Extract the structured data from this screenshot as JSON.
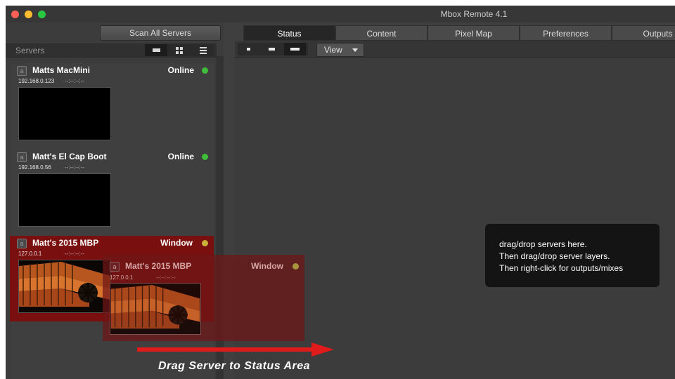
{
  "window": {
    "title": "Mbox Remote 4.1",
    "traffic_lights": {
      "close": "#fe5f57",
      "minimize": "#febc2e",
      "zoom": "#28c840"
    }
  },
  "left": {
    "scan_button_label": "Scan All Servers",
    "servers_label": "Servers",
    "view_modes": [
      "list-view-icon",
      "grid-view-icon",
      "detail-view-icon"
    ]
  },
  "servers": [
    {
      "name": "Matts MacMini",
      "icon_letter": "a",
      "ip": "192.168.0.123",
      "time": "--:--:--:--",
      "status": "Online",
      "status_color": "#3fbd3a",
      "selected": false,
      "thumbnail": "black"
    },
    {
      "name": "Matt's El Cap Boot",
      "icon_letter": "a",
      "ip": "192.168.0.56",
      "time": "--:--:--:--",
      "status": "Online",
      "status_color": "#3fbd3a",
      "selected": false,
      "thumbnail": "black"
    },
    {
      "name": "Matt's 2015 MBP",
      "icon_letter": "a",
      "ip": "127.0.0.1",
      "time": "--:--:--:--",
      "status": "Window",
      "status_color": "#c9b23a",
      "selected": true,
      "thumbnail": "orange-render"
    }
  ],
  "drag_ghost": {
    "name": "Matt's 2015 MBP",
    "ip": "127.0.0.1",
    "time": "--:--:--:--",
    "status": "Window",
    "status_color": "#c9b23a"
  },
  "tabs": [
    {
      "label": "Status",
      "active": true
    },
    {
      "label": "Content",
      "active": false
    },
    {
      "label": "Pixel Map",
      "active": false
    },
    {
      "label": "Preferences",
      "active": false
    },
    {
      "label": "Outputs",
      "active": false
    }
  ],
  "status_toolbar": {
    "size_modes": [
      "small-layout-icon",
      "medium-layout-icon",
      "large-layout-icon"
    ],
    "view_label": "View"
  },
  "hint": {
    "line1": "drag/drop servers here.",
    "line2": "Then drag/drop server layers.",
    "line3": "Then right-click for outputs/mixes"
  },
  "annotation": {
    "caption": "Drag Server to Status Area",
    "arrow_color": "#e01b1b"
  },
  "colors": {
    "selected_bg": "#8a1010",
    "panel_bg": "#3f3f3f"
  }
}
